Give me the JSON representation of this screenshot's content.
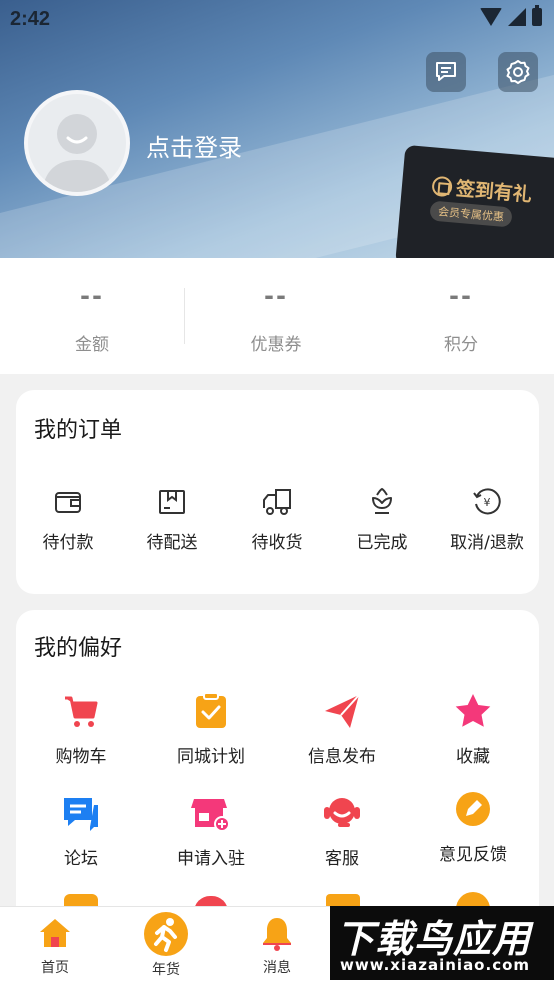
{
  "status_bar": {
    "time": "2:42"
  },
  "header": {
    "login_text": "点击登录",
    "signin": {
      "title": "签到有礼",
      "subtitle": "会员专属优惠"
    },
    "icons": [
      "message-icon",
      "settings-icon"
    ]
  },
  "stats": [
    {
      "value": "--",
      "label": "金额"
    },
    {
      "value": "--",
      "label": "优惠券"
    },
    {
      "value": "--",
      "label": "积分"
    }
  ],
  "orders": {
    "title": "我的订单",
    "items": [
      {
        "label": "待付款",
        "icon": "wallet-icon"
      },
      {
        "label": "待配送",
        "icon": "package-icon"
      },
      {
        "label": "待收货",
        "icon": "truck-icon"
      },
      {
        "label": "已完成",
        "icon": "flower-icon"
      },
      {
        "label": "取消/退款",
        "icon": "refund-icon"
      }
    ]
  },
  "preferences": {
    "title": "我的偏好",
    "items": [
      {
        "label": "购物车",
        "icon": "cart-icon",
        "color": "#f0454f"
      },
      {
        "label": "同城计划",
        "icon": "clipboard-check-icon",
        "color": "#f7a316"
      },
      {
        "label": "信息发布",
        "icon": "paper-plane-icon",
        "color": "#f0454f"
      },
      {
        "label": "收藏",
        "icon": "star-icon",
        "color": "#f4387a"
      },
      {
        "label": "论坛",
        "icon": "chat-icon",
        "color": "#1d7ff2"
      },
      {
        "label": "申请入驻",
        "icon": "store-add-icon",
        "color": "#f4387a"
      },
      {
        "label": "客服",
        "icon": "headset-icon",
        "color": "#f0454f"
      },
      {
        "label": "意见反馈",
        "icon": "pencil-icon",
        "color": "#f7a316"
      }
    ]
  },
  "bottom_nav": {
    "items": [
      {
        "label": "首页",
        "icon": "home-icon"
      },
      {
        "label": "年货",
        "icon": "runner-icon"
      },
      {
        "label": "消息",
        "icon": "bell-icon"
      }
    ]
  },
  "watermark": {
    "text": "下载鸟应用",
    "url": "www.xiazainiao.com"
  }
}
